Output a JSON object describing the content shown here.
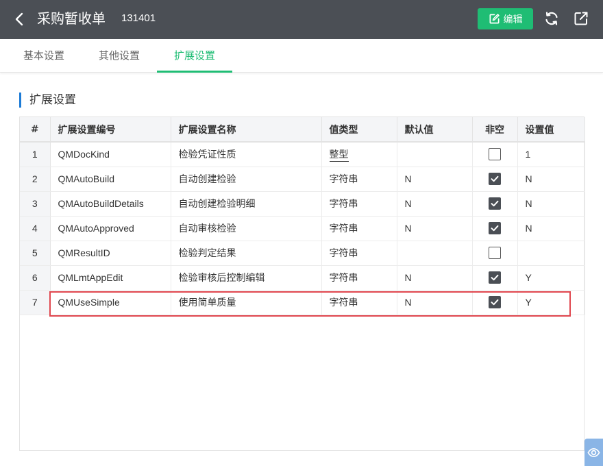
{
  "header": {
    "title": "采购暂收单",
    "doc_no": "131401",
    "edit_label": "编辑"
  },
  "tabs": [
    {
      "label": "基本设置",
      "active": false
    },
    {
      "label": "其他设置",
      "active": false
    },
    {
      "label": "扩展设置",
      "active": true
    }
  ],
  "section": {
    "title": "扩展设置"
  },
  "table": {
    "columns": [
      "#",
      "扩展设置编号",
      "扩展设置名称",
      "值类型",
      "默认值",
      "非空",
      "设置值"
    ],
    "rows": [
      {
        "index": "1",
        "code": "QMDocKind",
        "name": "检验凭证性质",
        "type": "整型",
        "default": "",
        "required": false,
        "value": "1"
      },
      {
        "index": "2",
        "code": "QMAutoBuild",
        "name": "自动创建检验",
        "type": "字符串",
        "default": "N",
        "required": true,
        "value": "N"
      },
      {
        "index": "3",
        "code": "QMAutoBuildDetails",
        "name": "自动创建检验明细",
        "type": "字符串",
        "default": "N",
        "required": true,
        "value": "N"
      },
      {
        "index": "4",
        "code": "QMAutoApproved",
        "name": "自动审核检验",
        "type": "字符串",
        "default": "N",
        "required": true,
        "value": "N"
      },
      {
        "index": "5",
        "code": "QMResultID",
        "name": "检验判定结果",
        "type": "字符串",
        "default": "",
        "required": false,
        "value": ""
      },
      {
        "index": "6",
        "code": "QMLmtAppEdit",
        "name": "检验审核后控制编辑",
        "type": "字符串",
        "default": "N",
        "required": true,
        "value": "Y"
      },
      {
        "index": "7",
        "code": "QMUseSimple",
        "name": "使用简单质量",
        "type": "字符串",
        "default": "N",
        "required": true,
        "value": "Y"
      }
    ]
  },
  "colors": {
    "topbar": "#4b4f55",
    "accent": "#1fbd74",
    "section_marker": "#1d7bd6",
    "highlight": "#e0464e",
    "checkbox_checked": "#4b4f55"
  },
  "icons": {
    "back": "chevron-left-icon",
    "edit": "edit-icon",
    "refresh": "refresh-icon",
    "share": "share-icon",
    "eye": "eye-icon"
  }
}
